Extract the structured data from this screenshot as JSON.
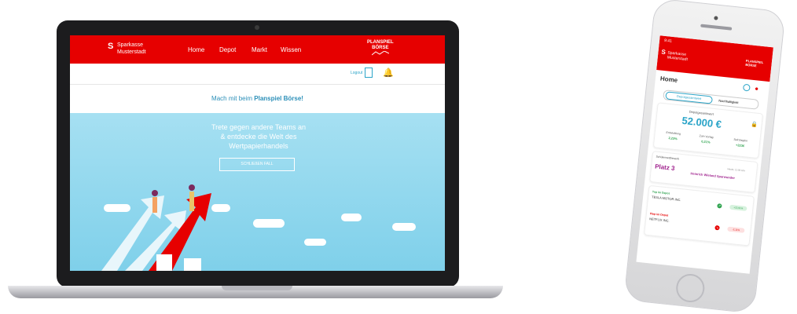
{
  "laptop": {
    "nav": {
      "logo_line1": "Sparkasse",
      "logo_line2": "Musterstadt",
      "items": [
        "Home",
        "Depot",
        "Markt",
        "Wissen"
      ],
      "brand_line1": "PLANSPIEL",
      "brand_line2": "BÖRSE"
    },
    "toolbar": {
      "logout_label": "Logout"
    },
    "tagline": {
      "prefix": "Mach mit beim ",
      "highlight": "Planspiel Börse!"
    },
    "hero": {
      "line1": "Trete gegen andere Teams an",
      "line2": "& entdecke die Welt des",
      "line3": "Wertpapierhandels",
      "button_label": "SCHLIEßEN FALL"
    }
  },
  "phone": {
    "status_time": "9:41",
    "logo_line1": "Sparkasse",
    "logo_line2": "Musterstadt",
    "brand_line1": "PLANSPIEL",
    "brand_line2": "BÖRSE",
    "title": "Home",
    "tabs": [
      "Depotgesamtwert",
      "Nachhaltigkeit"
    ],
    "depot": {
      "label": "Depotgesamtwert",
      "value": "52.000 €",
      "metrics": [
        {
          "label": "Entwicklung",
          "value": "2,23%"
        },
        {
          "label": "Zum Vortag",
          "value": "0,21%"
        },
        {
          "label": "Seit Beginn",
          "value": "+223€"
        }
      ]
    },
    "ranking": {
      "label": "Schülerwettbewerb",
      "time": "Heute, 11:00 Uhr",
      "place": "Platz 3",
      "team": "Heinrich Wieland Sparwunder"
    },
    "top": {
      "label": "Top im Depot",
      "name": "TESLA MOTOR INC.",
      "change": "+22,61%"
    },
    "flop": {
      "label": "Flop im Depot",
      "name": "NETFLIX INC.",
      "change": "-2,11%"
    }
  }
}
